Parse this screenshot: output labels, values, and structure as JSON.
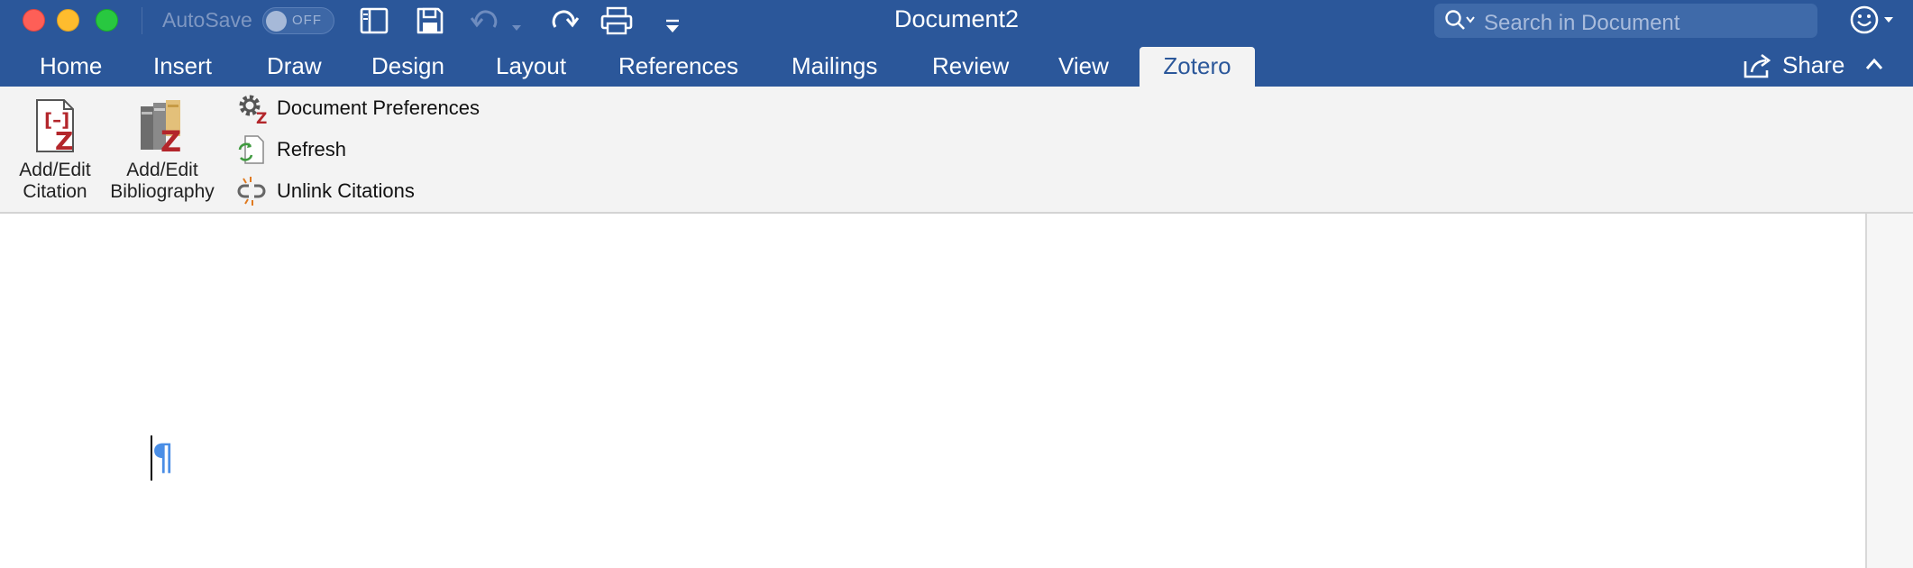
{
  "titlebar": {
    "document_title": "Document2",
    "autosave_label": "AutoSave",
    "autosave_state": "OFF",
    "search_placeholder": "Search in Document"
  },
  "tabs": [
    {
      "label": "Home",
      "active": false
    },
    {
      "label": "Insert",
      "active": false
    },
    {
      "label": "Draw",
      "active": false
    },
    {
      "label": "Design",
      "active": false
    },
    {
      "label": "Layout",
      "active": false
    },
    {
      "label": "References",
      "active": false
    },
    {
      "label": "Mailings",
      "active": false
    },
    {
      "label": "Review",
      "active": false
    },
    {
      "label": "View",
      "active": false
    },
    {
      "label": "Zotero",
      "active": true
    }
  ],
  "share": {
    "label": "Share"
  },
  "ribbon": {
    "add_edit_citation": {
      "line1": "Add/Edit",
      "line2": "Citation"
    },
    "add_edit_bibliography": {
      "line1": "Add/Edit",
      "line2": "Bibliography"
    },
    "document_preferences": "Document Preferences",
    "refresh": "Refresh",
    "unlink_citations": "Unlink Citations"
  },
  "document": {
    "paragraph_mark": "¶"
  },
  "colors": {
    "titlebar": "#2b579a",
    "ribbon": "#f3f3f3",
    "zotero_red": "#b3262b",
    "pilcrow": "#4a8ee6"
  }
}
